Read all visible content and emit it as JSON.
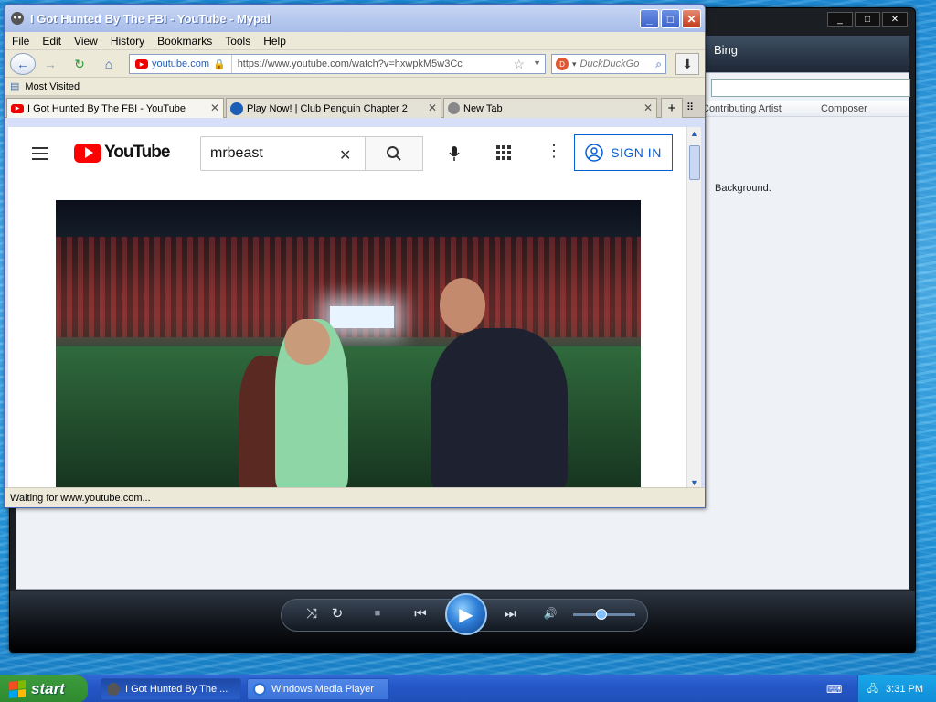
{
  "wmp": {
    "title_buttons": [
      "_",
      "□",
      "✕"
    ],
    "tab_label": "Bing",
    "columns": [
      "Contributing Artist",
      "Composer"
    ],
    "message": "Background.",
    "controls": {
      "shuffle": "⤨",
      "repeat": "↻",
      "stop": "■",
      "prev": "⏮",
      "play": "▶",
      "next": "⏭",
      "mute": "🔊"
    },
    "volume_level": 0.45
  },
  "browser": {
    "title": "I Got Hunted By The FBI - YouTube - Mypal",
    "menu": [
      "File",
      "Edit",
      "View",
      "History",
      "Bookmarks",
      "Tools",
      "Help"
    ],
    "site_identity": "youtube.com",
    "url": "https://www.youtube.com/watch?v=hxwpkM5w3Cc",
    "search_engine": "DuckDuckGo",
    "bookmarks": [
      "Most Visited"
    ],
    "tabs": [
      {
        "label": "I Got Hunted By The FBI - YouTube"
      },
      {
        "label": "Play Now! | Club Penguin Chapter 2"
      },
      {
        "label": "New Tab"
      }
    ],
    "status": "Waiting for www.youtube.com..."
  },
  "youtube": {
    "logo_text": "YouTube",
    "search_value": "mrbeast",
    "sign_in": "SIGN IN"
  },
  "taskbar": {
    "start_label": "start",
    "items": [
      {
        "label": "I Got Hunted By The ..."
      },
      {
        "label": "Windows Media Player"
      }
    ],
    "clock": "3:31 PM"
  },
  "colors": {
    "youtube_red": "#ff0000",
    "signin_blue": "#065fd4",
    "xp_blue": "#2456c7",
    "start_green": "#2f8a2f"
  }
}
